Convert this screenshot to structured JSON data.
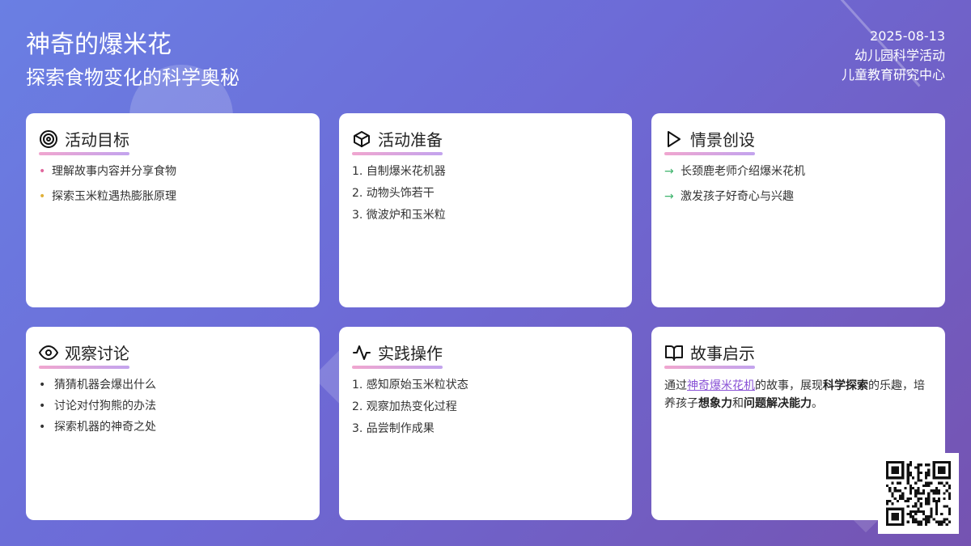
{
  "header": {
    "title": "神奇的爆米花",
    "subtitle": "探索食物变化的科学奥秘",
    "date": "2025-08-13",
    "activity_type": "幼儿园科学活动",
    "organization": "儿童教育研究中心"
  },
  "cards": {
    "goals": {
      "title": "活动目标",
      "icon": "target-icon",
      "items": [
        "理解故事内容并分享食物",
        "探索玉米粒遇热膨胀原理"
      ]
    },
    "preparation": {
      "title": "活动准备",
      "icon": "box-icon",
      "items": [
        "1. 自制爆米花机器",
        "2. 动物头饰若干",
        "3. 微波炉和玉米粒"
      ]
    },
    "scenario": {
      "title": "情景创设",
      "icon": "play-icon",
      "items": [
        "长颈鹿老师介绍爆米花机",
        "激发孩子好奇心与兴趣"
      ]
    },
    "discussion": {
      "title": "观察讨论",
      "icon": "eye-icon",
      "items": [
        "猜猜机器会爆出什么",
        "讨论对付狗熊的办法",
        "探索机器的神奇之处"
      ]
    },
    "practice": {
      "title": "实践操作",
      "icon": "activity-pulse-icon",
      "items": [
        "1. 感知原始玉米粒状态",
        "2. 观察加热变化过程",
        "3. 品尝制作成果"
      ]
    },
    "insight": {
      "title": "故事启示",
      "icon": "open-book-icon",
      "text_1": "通过",
      "link": "神奇爆米花机",
      "text_2": "的故事，展现",
      "bold_1": "科学探索",
      "text_3": "的乐趣，培养孩子",
      "bold_2": "想象力",
      "text_4": "和",
      "bold_3": "问题解决能力",
      "text_5": "。"
    }
  },
  "colors": {
    "bg_start": "#6a7fe3",
    "bg_end": "#7553b1",
    "underline_start": "#f0a6cf",
    "underline_end": "#c3a4ee",
    "link": "#8a53d6",
    "arrow": "#3fb46d"
  },
  "qr": {
    "icon": "qr-code-icon"
  }
}
